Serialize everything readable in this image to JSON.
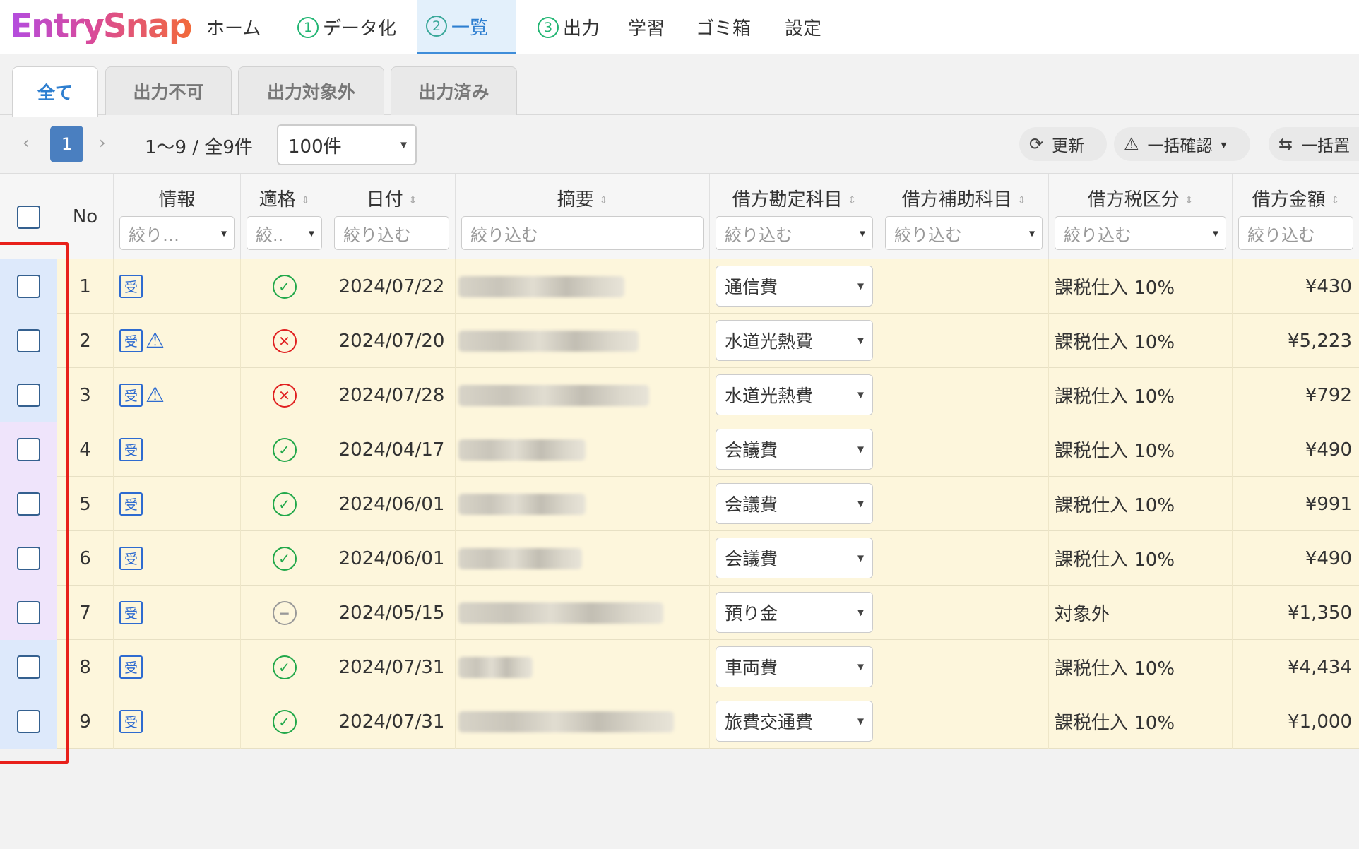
{
  "app": {
    "logo": "EntrySnap"
  },
  "nav": {
    "items": [
      {
        "label": "ホーム",
        "num": ""
      },
      {
        "label": "データ化",
        "num": "1"
      },
      {
        "label": "一覧",
        "num": "2"
      },
      {
        "label": "出力",
        "num": "3"
      },
      {
        "label": "学習",
        "num": ""
      },
      {
        "label": "ゴミ箱",
        "num": ""
      },
      {
        "label": "設定",
        "num": ""
      }
    ],
    "active_index": 2
  },
  "tabs": [
    "全て",
    "出力不可",
    "出力対象外",
    "出力済み"
  ],
  "toolbar": {
    "page": "1",
    "count": "1〜9 / 全9件",
    "per_page": "100件",
    "refresh": "更新",
    "bulk_confirm": "一括確認",
    "bulk_replace": "一括置"
  },
  "columns": {
    "no": "No",
    "info": "情報",
    "valid": "適格",
    "date": "日付",
    "summary": "摘要",
    "debit_account": "借方勘定科目",
    "debit_sub": "借方補助科目",
    "debit_tax": "借方税区分",
    "debit_amount": "借方金額"
  },
  "filters": {
    "info": "絞り…",
    "valid": "絞..",
    "date": "絞り込む",
    "summary": "絞り込む",
    "debit_account": "絞り込む",
    "debit_sub": "絞り込む",
    "debit_tax": "絞り込む",
    "debit_amount": "絞り込む"
  },
  "icons": {
    "received": "受",
    "warning": "⚠"
  },
  "rows": [
    {
      "no": "1",
      "warn": false,
      "status": "ok",
      "date": "2024/07/22",
      "account": "通信費",
      "tax": "課税仕入 10%",
      "amount": "¥430"
    },
    {
      "no": "2",
      "warn": true,
      "status": "ng",
      "date": "2024/07/20",
      "account": "水道光熱費",
      "tax": "課税仕入 10%",
      "amount": "¥5,223"
    },
    {
      "no": "3",
      "warn": true,
      "status": "ng",
      "date": "2024/07/28",
      "account": "水道光熱費",
      "tax": "課税仕入 10%",
      "amount": "¥792"
    },
    {
      "no": "4",
      "warn": false,
      "status": "ok",
      "date": "2024/04/17",
      "account": "会議費",
      "tax": "課税仕入 10%",
      "amount": "¥490"
    },
    {
      "no": "5",
      "warn": false,
      "status": "ok",
      "date": "2024/06/01",
      "account": "会議費",
      "tax": "課税仕入 10%",
      "amount": "¥991"
    },
    {
      "no": "6",
      "warn": false,
      "status": "ok",
      "date": "2024/06/01",
      "account": "会議費",
      "tax": "課税仕入 10%",
      "amount": "¥490"
    },
    {
      "no": "7",
      "warn": false,
      "status": "na",
      "date": "2024/05/15",
      "account": "預り金",
      "tax": "対象外",
      "amount": "¥1,350"
    },
    {
      "no": "8",
      "warn": false,
      "status": "ok",
      "date": "2024/07/31",
      "account": "車両費",
      "tax": "課税仕入 10%",
      "amount": "¥4,434"
    },
    {
      "no": "9",
      "warn": false,
      "status": "ok",
      "date": "2024/07/31",
      "account": "旅費交通費",
      "tax": "課税仕入 10%",
      "amount": "¥1,000"
    }
  ],
  "colors": {
    "row_bg": "#fdf6dc",
    "checkbox_cell_blue": "#dde9fb",
    "checkbox_cell_purple": "#efe4fb",
    "highlight_box": "#e8201a",
    "accent": "#2e7fd0"
  }
}
